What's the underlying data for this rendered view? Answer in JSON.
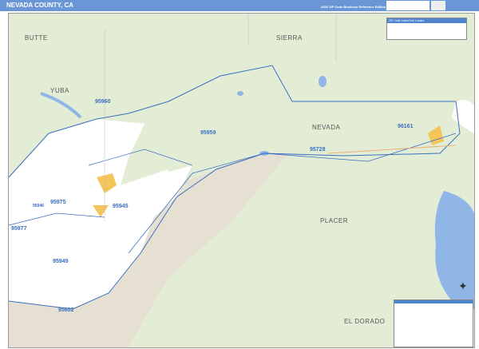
{
  "header": {
    "title": "NEVADA COUNTY, CA",
    "subtitle": "2026 ZIP Code Business Reference Edition"
  },
  "colors": {
    "header": "#6b96d6",
    "land": "#e3edd6",
    "county": "#ffffff",
    "valley": "#e6e0d2",
    "water": "#8fb6e6",
    "zip_boundary": "#3a6fc0",
    "urban": "#f3c55a"
  },
  "counties": [
    "BUTTE",
    "SIERRA",
    "YUBA",
    "NEVADA",
    "PLACER",
    "EL DORADO"
  ],
  "zips": [
    "95960",
    "95959",
    "95728",
    "96161",
    "95975",
    "95946",
    "95945",
    "95977",
    "95949",
    "95602"
  ],
  "zip_index": {
    "title": "ZIP Code Index/Grid Locator"
  },
  "icons": [
    "compass-rose-icon"
  ]
}
